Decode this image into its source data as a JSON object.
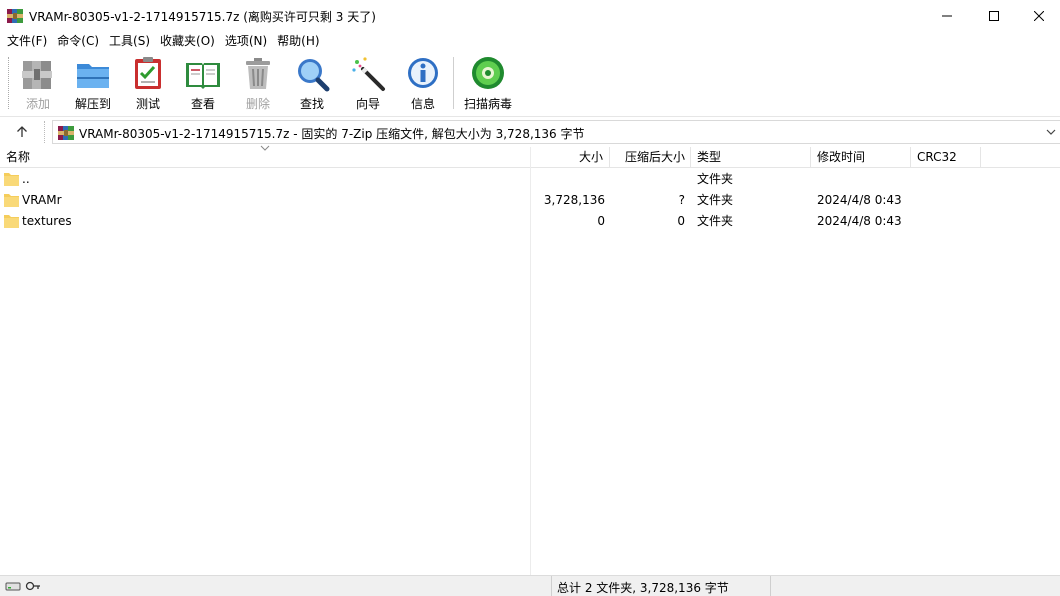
{
  "window": {
    "title": "VRAMr-80305-v1-2-1714915715.7z (离购买许可只剩 3 天了)",
    "icons": {
      "app": "winrar-books-icon",
      "minimize": "minimize-icon",
      "maximize": "maximize-icon",
      "close": "close-icon"
    }
  },
  "menu": [
    "文件(F)",
    "命令(C)",
    "工具(S)",
    "收藏夹(O)",
    "选项(N)",
    "帮助(H)"
  ],
  "toolbar": [
    {
      "label": "添加",
      "icon": "add-archive-icon",
      "disabled": true
    },
    {
      "label": "解压到",
      "icon": "extract-folder-icon",
      "disabled": false
    },
    {
      "label": "测试",
      "icon": "test-clipboard-icon",
      "disabled": false
    },
    {
      "label": "查看",
      "icon": "view-book-icon",
      "disabled": false
    },
    {
      "label": "删除",
      "icon": "trash-icon",
      "disabled": true
    },
    {
      "label": "查找",
      "icon": "magnifier-icon",
      "disabled": false
    },
    {
      "label": "向导",
      "icon": "wizard-wand-icon",
      "disabled": false
    },
    {
      "label": "信息",
      "icon": "info-icon",
      "disabled": false
    },
    {
      "label": "扫描病毒",
      "icon": "virus-scan-icon",
      "disabled": false
    }
  ],
  "address": {
    "text": "VRAMr-80305-v1-2-1714915715.7z - 固实的 7-Zip 压缩文件, 解包大小为 3,728,136 字节",
    "icon": "archive-icon",
    "up_icon": "up-arrow-icon",
    "dropdown_icon": "chevron-down-icon"
  },
  "columns": {
    "name": "名称",
    "size": "大小",
    "packed": "压缩后大小",
    "type": "类型",
    "modified": "修改时间",
    "crc": "CRC32"
  },
  "files": [
    {
      "name": "..",
      "size": "",
      "packed": "",
      "type": "文件夹",
      "modified": "",
      "crc": ""
    },
    {
      "name": "VRAMr",
      "size": "3,728,136",
      "packed": "?",
      "type": "文件夹",
      "modified": "2024/4/8 0:43",
      "crc": ""
    },
    {
      "name": "textures",
      "size": "0",
      "packed": "0",
      "type": "文件夹",
      "modified": "2024/4/8 0:43",
      "crc": ""
    }
  ],
  "status": {
    "summary": "总计 2 文件夹, 3,728,136 字节",
    "left_icons": "drive-key-icon"
  },
  "colors": {
    "folder": "#f5cd5b",
    "disabled_text": "#a0a0a0",
    "status_bg": "#f0f0f0"
  }
}
